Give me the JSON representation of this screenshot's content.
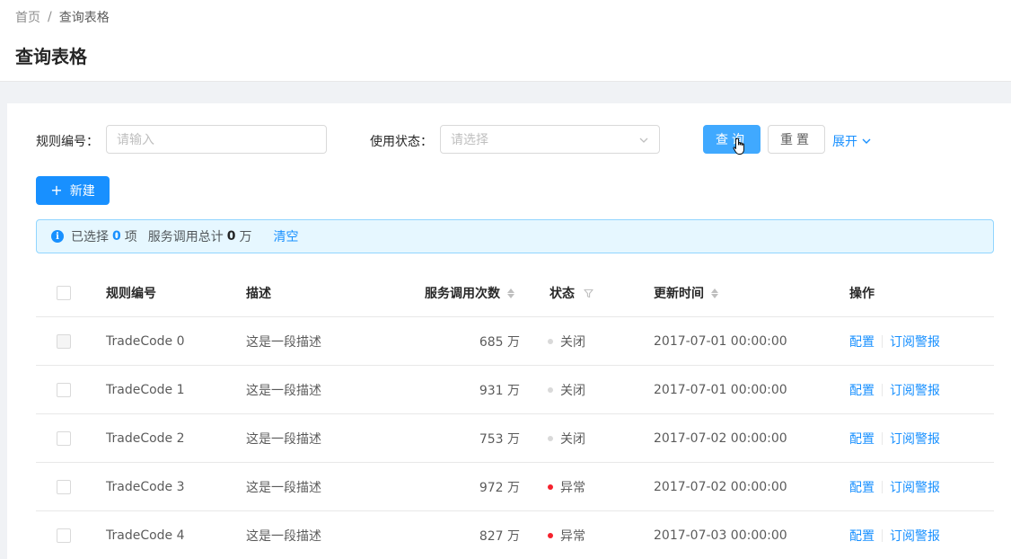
{
  "breadcrumb": {
    "home": "首页",
    "separator": "/",
    "current": "查询表格"
  },
  "page_title": "查询表格",
  "form": {
    "rule_label": "规则编号：",
    "rule_placeholder": "请输入",
    "status_label": "使用状态：",
    "status_placeholder": "请选择",
    "query_button": "查询",
    "reset_button": "重置",
    "expand_link": "展开"
  },
  "new_button": {
    "icon": "plus-icon",
    "label": "新建"
  },
  "alert": {
    "selected_prefix": "已选择",
    "selected_count": "0",
    "selected_suffix": "项",
    "total_prefix": "服务调用总计",
    "total_count": "0",
    "total_suffix": "万",
    "clear": "清空"
  },
  "table": {
    "columns": {
      "rule_no": "规则编号",
      "desc": "描述",
      "calls": "服务调用次数",
      "status": "状态",
      "updated": "更新时间",
      "action": "操作"
    },
    "rows": [
      {
        "name": "TradeCode 0",
        "desc": "这是一段描述",
        "calls": "685 万",
        "status": "关闭",
        "status_color": "#d9d9d9",
        "updated": "2017-07-01 00:00:00",
        "action1": "配置",
        "action2": "订阅警报",
        "checkbox_disabled": true
      },
      {
        "name": "TradeCode 1",
        "desc": "这是一段描述",
        "calls": "931 万",
        "status": "关闭",
        "status_color": "#d9d9d9",
        "updated": "2017-07-01 00:00:00",
        "action1": "配置",
        "action2": "订阅警报",
        "checkbox_disabled": false
      },
      {
        "name": "TradeCode 2",
        "desc": "这是一段描述",
        "calls": "753 万",
        "status": "关闭",
        "status_color": "#d9d9d9",
        "updated": "2017-07-02 00:00:00",
        "action1": "配置",
        "action2": "订阅警报",
        "checkbox_disabled": false
      },
      {
        "name": "TradeCode 3",
        "desc": "这是一段描述",
        "calls": "972 万",
        "status": "异常",
        "status_color": "#f5222d",
        "updated": "2017-07-02 00:00:00",
        "action1": "配置",
        "action2": "订阅警报",
        "checkbox_disabled": false
      },
      {
        "name": "TradeCode 4",
        "desc": "这是一段描述",
        "calls": "827 万",
        "status": "异常",
        "status_color": "#f5222d",
        "updated": "2017-07-03 00:00:00",
        "action1": "配置",
        "action2": "订阅警报",
        "checkbox_disabled": false
      }
    ]
  },
  "colors": {
    "primary": "#1890ff",
    "primary_hover": "#40a9ff",
    "alert_bg": "#e6f7ff",
    "alert_border": "#91d5ff",
    "error": "#f5222d",
    "default_dot": "#d9d9d9"
  }
}
